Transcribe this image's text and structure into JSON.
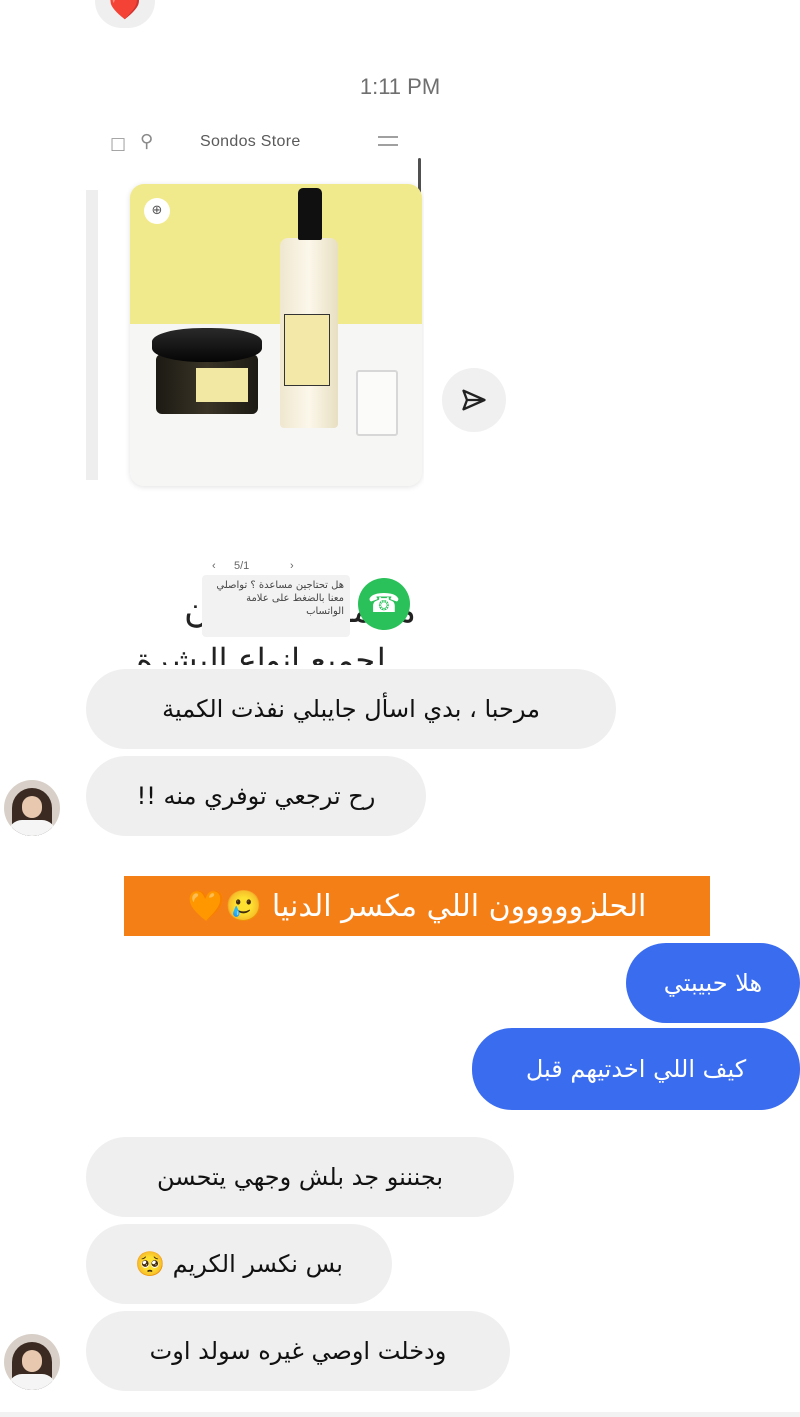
{
  "reaction": {
    "emoji": "❤️"
  },
  "timestamp": "1:11 PM",
  "shared_post": {
    "store_name": "Sondos Store",
    "pager": {
      "prev": "‹",
      "page": "5/1",
      "next": "›"
    },
    "whatsapp_tooltip": "هل تحتاجين مساعدة ؟ تواصلي معنا بالضغط على علامة الواتساب",
    "promo_line1": "مجموعة حلزون",
    "promo_line2": "لجميع انواع البشرة"
  },
  "messages": [
    {
      "side": "in",
      "text": "مرحبا ، بدي اسأل جايبلي نفذت الكمية"
    },
    {
      "side": "in",
      "text": "رح ترجعي توفري منه !!"
    },
    {
      "side": "out",
      "text": "هلا حبيبتي"
    },
    {
      "side": "out",
      "text": "كيف اللي اخدتيهم قبل"
    },
    {
      "side": "in",
      "text": "بجنننو جد بلش وجهي يتحسن"
    },
    {
      "side": "in",
      "text": "بس نكسر الكريم 🥺"
    },
    {
      "side": "in",
      "text": "ودخلت اوصي غيره سولد اوت"
    }
  ],
  "banner": {
    "text": "الحلزووووون اللي مكسر الدنيا 🥲🧡"
  },
  "colors": {
    "outgoing": "#3a6cf0",
    "incoming": "#efefef",
    "banner": "#f57f17",
    "whatsapp": "#2bc15a"
  },
  "icons": [
    "heart-icon",
    "bag-icon",
    "search-icon",
    "menu-icon",
    "zoom-icon",
    "whatsapp-icon",
    "send-icon",
    "avatar"
  ]
}
